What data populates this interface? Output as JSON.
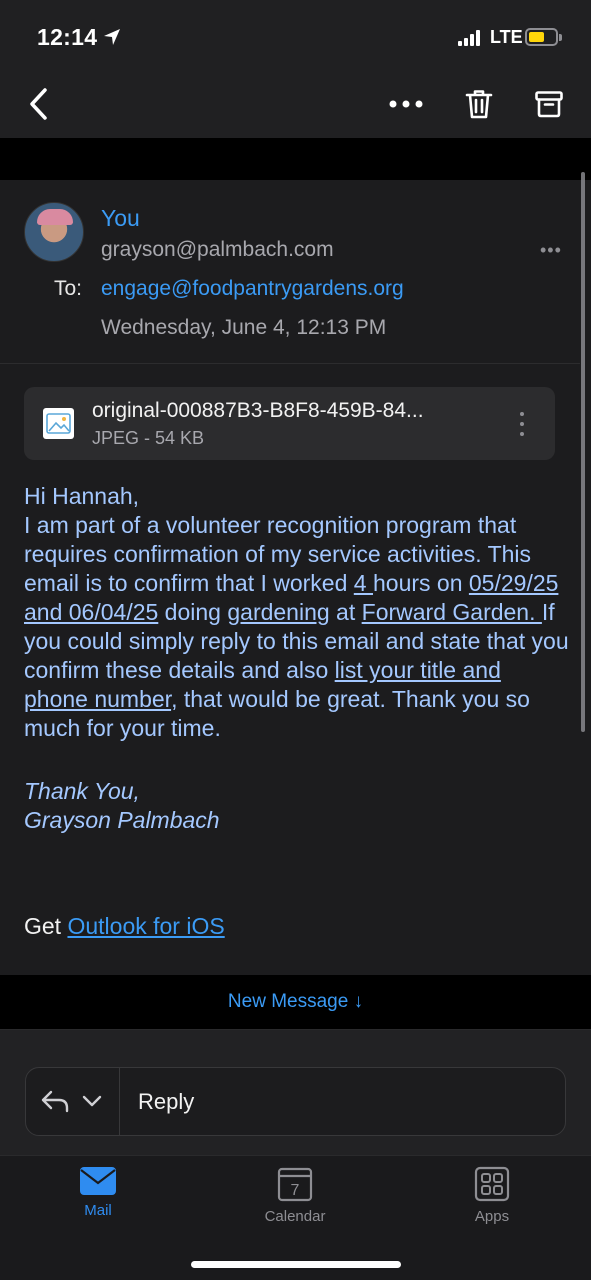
{
  "status_bar": {
    "time": "12:14",
    "network": "LTE",
    "icons": [
      "location-arrow-icon",
      "signal-icon",
      "battery-icon"
    ],
    "battery_color": "#ffd60a"
  },
  "toolbar": {
    "icons": [
      "back-chevron-icon",
      "more-icon",
      "trash-icon",
      "archive-icon"
    ]
  },
  "message": {
    "sender_name": "You",
    "sender_email": "grayson@palmbach.com",
    "to_label": "To:",
    "to_address": "engage@foodpantrygardens.org",
    "date": "Wednesday, June 4, 12:13 PM",
    "attachment": {
      "name": "original-000887B3-B8F8-459B-84...",
      "meta": "JPEG - 54 KB"
    },
    "greeting": "Hi Hannah,",
    "body_1": "I am part of a volunteer recognition program that requires confirmation of my service activities. This email is to confirm that I worked ",
    "hours": "4 ",
    "body_2": "hours on ",
    "dates": "05/29/25 and 06/04/25",
    "body_3": " doing ",
    "activity": "gardening",
    "body_4": " at ",
    "location": "Forward Garden. ",
    "body_5": "If you could simply reply to this email and state that you confirm these details and also ",
    "request": "list your title and phone number",
    "body_6": ", that would be great. Thank you so much for your time.",
    "signoff_1": "Thank You,",
    "signoff_2": "Grayson Palmbach",
    "footer_prefix": "Get ",
    "footer_link": "Outlook for iOS"
  },
  "new_message": "New Message ↓",
  "reply": {
    "label": "Reply"
  },
  "tabs": [
    {
      "label": "Mail",
      "icon": "mail-icon",
      "active": true
    },
    {
      "label": "Calendar",
      "icon": "calendar-icon",
      "day": "7",
      "active": false
    },
    {
      "label": "Apps",
      "icon": "apps-grid-icon",
      "active": false
    }
  ],
  "accent_color": "#3b9bf5"
}
